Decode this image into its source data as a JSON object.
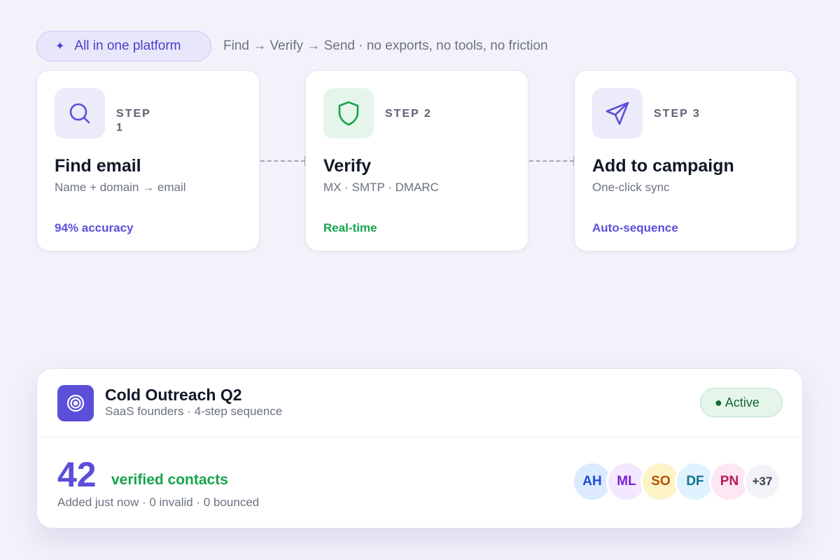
{
  "header": {
    "pill_label": "All in one platform",
    "tagline": "Find → Verify → Send · no exports, no tools, no friction"
  },
  "steps": [
    {
      "step_line1": "STEP",
      "step_line2": "1",
      "title": "Find email",
      "description": "Name + domain → email",
      "footer": "94% accuracy",
      "icon": "search-icon",
      "accent": "#5b4fd9",
      "icon_bg": "#ecebfa"
    },
    {
      "step_line1": "STEP 2",
      "step_line2": "",
      "title": "Verify",
      "description": "MX · SMTP · DMARC",
      "footer": "Real-time",
      "icon": "shield-icon",
      "accent": "#16a34a",
      "icon_bg": "#e5f5ea"
    },
    {
      "step_line1": "STEP 3",
      "step_line2": "",
      "title": "Add to campaign",
      "description": "One-click sync",
      "footer": "Auto-sequence",
      "icon": "send-icon",
      "accent": "#5b4fd9",
      "icon_bg": "#ecebfa"
    }
  ],
  "campaign": {
    "icon": "target-icon",
    "name": "Cold Outreach Q2",
    "subtitle": "SaaS founders · 4-step sequence",
    "status": "● Active",
    "count": "42",
    "count_label": "verified contacts",
    "meta": "Added just now · 0 invalid · 0 bounced",
    "avatars": [
      {
        "initials": "AH",
        "bg": "#dbeafe",
        "fg": "#1d4ed8"
      },
      {
        "initials": "ML",
        "bg": "#f3e8ff",
        "fg": "#7e22ce"
      },
      {
        "initials": "SO",
        "bg": "#fef3c7",
        "fg": "#b45309"
      },
      {
        "initials": "DF",
        "bg": "#e0f2fe",
        "fg": "#0e7490"
      },
      {
        "initials": "PN",
        "bg": "#fce7f3",
        "fg": "#be185d"
      }
    ],
    "more_count": "+37"
  },
  "colors": {
    "brand": "#5b4fd9",
    "success": "#16a34a",
    "background": "#f3f2fa"
  }
}
